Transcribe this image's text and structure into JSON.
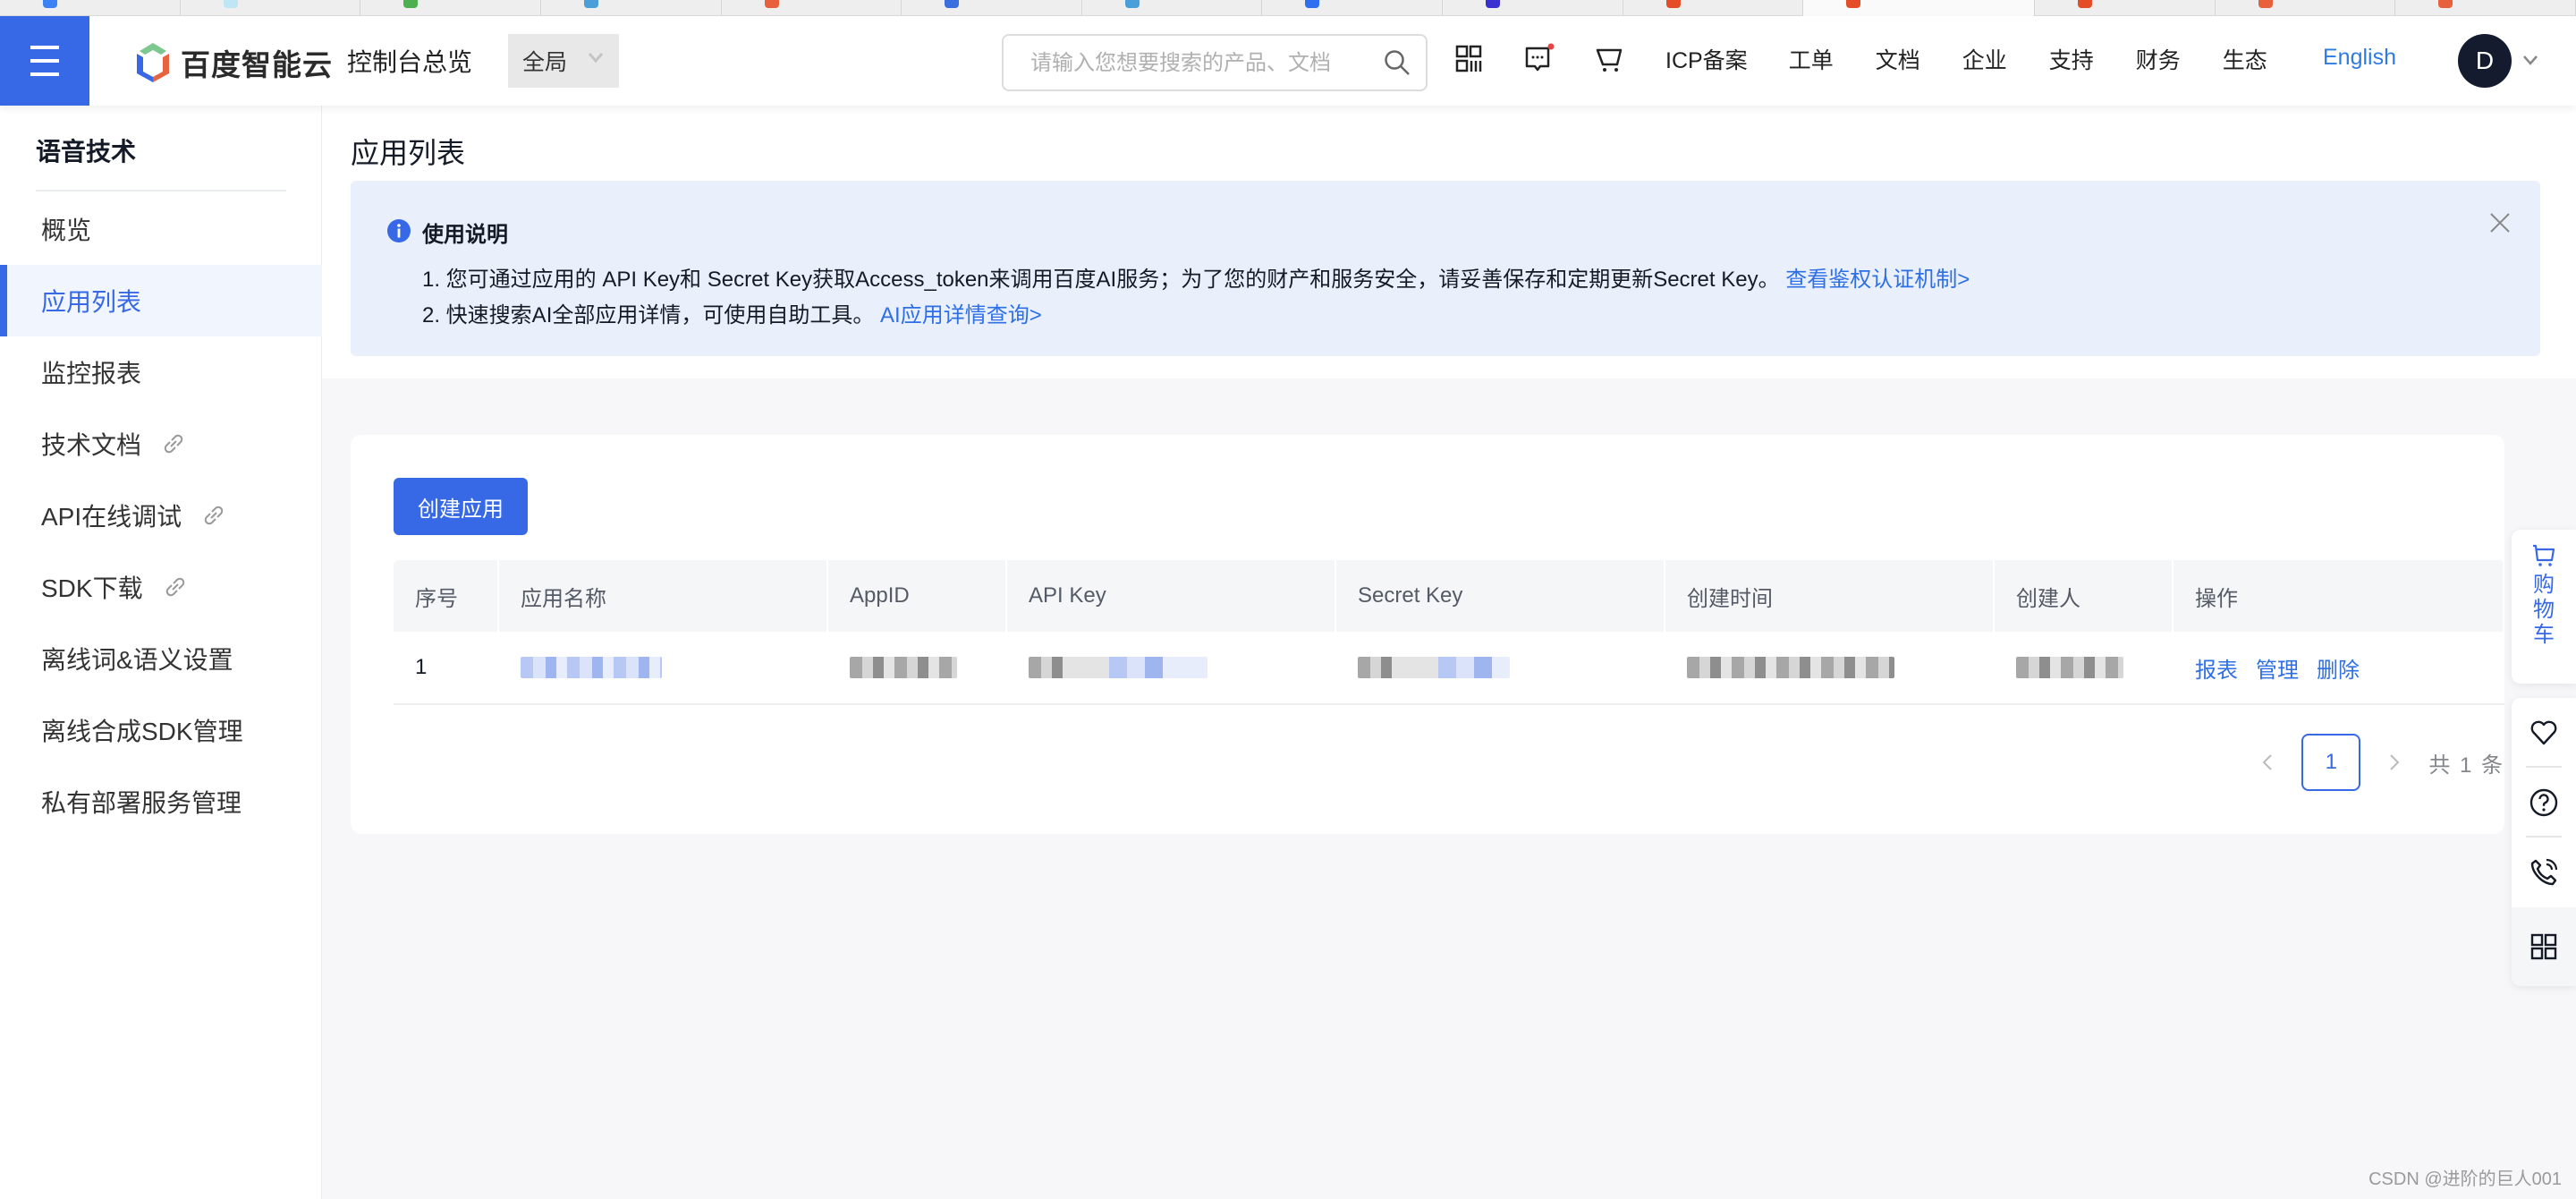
{
  "browser": {
    "tab_favicon_colors": [
      "#3b82f6",
      "#bfe6f5",
      "#4caf50",
      "#4a9fd8",
      "#e8603c",
      "#3b6fe0",
      "#4a9fd8",
      "#2f6ff0",
      "#3a2fd0",
      "#e44d26",
      "#e44d26",
      "#e44d26",
      "#e8603c",
      "#e8603c"
    ]
  },
  "topnav": {
    "brand": "百度智能云",
    "console_title": "控制台总览",
    "region_select": "全局",
    "search_placeholder": "请输入您想要搜索的产品、文档",
    "icons": [
      "qrcode-icon",
      "message-icon",
      "cart-icon"
    ],
    "links": [
      "ICP备案",
      "工单",
      "文档",
      "企业",
      "支持",
      "财务",
      "生态"
    ],
    "language": "English",
    "avatar_initial": "D"
  },
  "sidebar": {
    "title": "语音技术",
    "items": [
      {
        "label": "概览",
        "active": false,
        "external": false
      },
      {
        "label": "应用列表",
        "active": true,
        "external": false
      },
      {
        "label": "监控报表",
        "active": false,
        "external": false
      },
      {
        "label": "技术文档",
        "active": false,
        "external": true
      },
      {
        "label": "API在线调试",
        "active": false,
        "external": true
      },
      {
        "label": "SDK下载",
        "active": false,
        "external": true
      },
      {
        "label": "离线词&语义设置",
        "active": false,
        "external": false
      },
      {
        "label": "离线合成SDK管理",
        "active": false,
        "external": false
      },
      {
        "label": "私有部署服务管理",
        "active": false,
        "external": false
      }
    ]
  },
  "main": {
    "page_title": "应用列表",
    "notice": {
      "title": "使用说明",
      "line1_text": "1. 您可通过应用的 API Key和 Secret Key获取Access_token来调用百度AI服务；为了您的财产和服务安全，请妥善保存和定期更新Secret Key。",
      "line1_link": "查看鉴权认证机制>",
      "line2_text": "2. 快速搜索AI全部应用详情，可使用自助工具。",
      "line2_link": "AI应用详情查询>"
    },
    "create_button": "创建应用",
    "table": {
      "columns": [
        "序号",
        "应用名称",
        "AppID",
        "API Key",
        "Secret Key",
        "创建时间",
        "创建人",
        "操作"
      ],
      "rows": [
        {
          "seq": "1",
          "name": "[redacted]",
          "appid": "[redacted]",
          "api_key": "[redacted]",
          "secret_key": "[redacted]",
          "created_at": "[redacted]",
          "creator": "[redacted]",
          "actions": [
            "报表",
            "管理",
            "删除"
          ]
        }
      ]
    },
    "pagination": {
      "current_page": "1",
      "total_text": "共 1 条"
    }
  },
  "float_toolbar": {
    "cart_label": "购物车",
    "tools": [
      "favorite-icon",
      "help-icon",
      "phone-icon",
      "grid-icon"
    ]
  },
  "watermark": "CSDN @进阶的巨人001",
  "colors": {
    "brand_blue": "#3768e6",
    "link_blue": "#2e6fe6",
    "notice_bg": "#e9f0fc",
    "active_bg": "#f1f6fe"
  }
}
